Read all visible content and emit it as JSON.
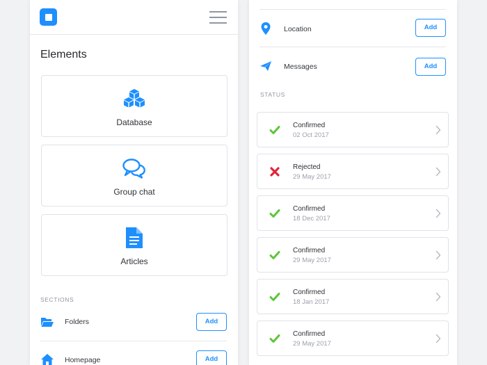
{
  "left": {
    "title": "Elements",
    "cards": [
      {
        "label": "Database",
        "icon": "database-icon"
      },
      {
        "label": "Group chat",
        "icon": "chat-icon"
      },
      {
        "label": "Articles",
        "icon": "document-icon"
      }
    ],
    "sections_label": "SECTIONS",
    "rows": [
      {
        "label": "Folders",
        "icon": "folder-icon",
        "button": "Add"
      },
      {
        "label": "Homepage",
        "icon": "home-icon",
        "button": "Add"
      }
    ]
  },
  "right": {
    "rows": [
      {
        "label": "Location",
        "icon": "location-pin-icon",
        "button": "Add"
      },
      {
        "label": "Messages",
        "icon": "paper-plane-icon",
        "button": "Add"
      }
    ],
    "status_label": "STATUS",
    "statuses": [
      {
        "title": "Confirmed",
        "date": "02 Oct 2017",
        "state": "confirmed"
      },
      {
        "title": "Rejected",
        "date": "29 May 2017",
        "state": "rejected"
      },
      {
        "title": "Confirmed",
        "date": "18 Dec 2017",
        "state": "confirmed"
      },
      {
        "title": "Confirmed",
        "date": "29 May 2017",
        "state": "confirmed"
      },
      {
        "title": "Confirmed",
        "date": "18 Jan 2017",
        "state": "confirmed"
      },
      {
        "title": "Confirmed",
        "date": "29 May 2017",
        "state": "confirmed"
      }
    ]
  },
  "colors": {
    "accent": "#1e8fff",
    "confirmed": "#5cc636",
    "rejected": "#e0263a",
    "background": "#f1f2f4"
  }
}
